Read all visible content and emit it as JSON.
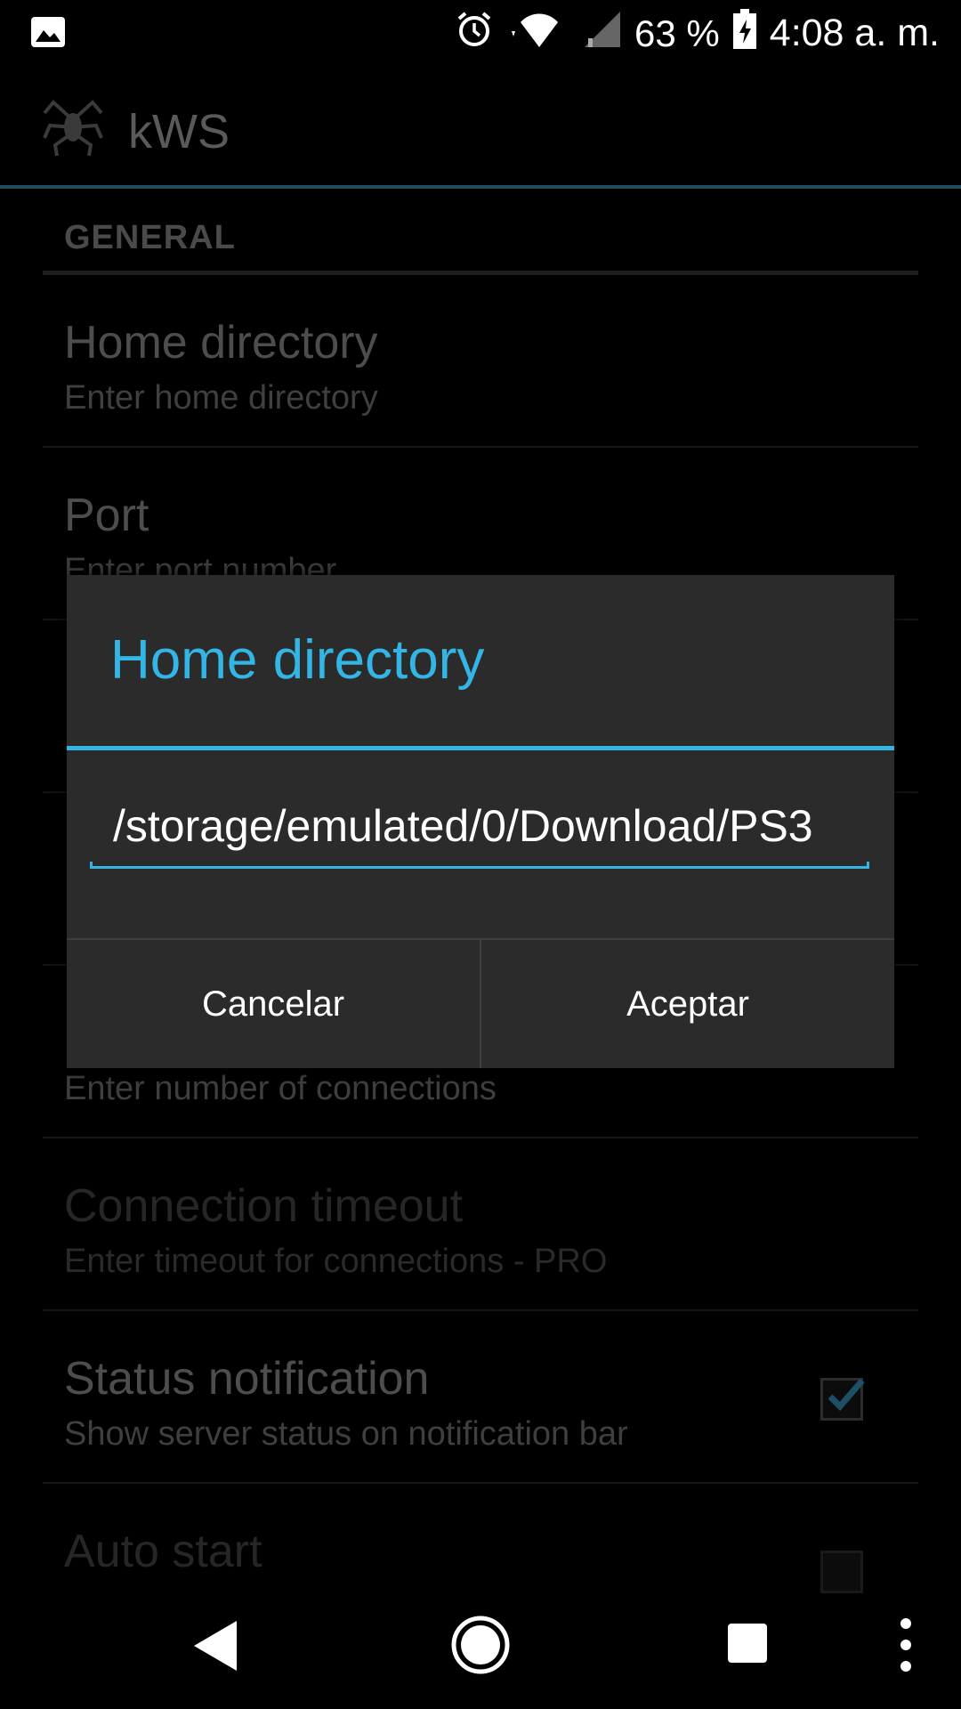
{
  "status_bar": {
    "battery_percent": "63 %",
    "time": "4:08 a. m.",
    "icons": [
      "image-icon",
      "alarm-icon",
      "wifi-icon",
      "signal-icon",
      "battery-charging-icon"
    ]
  },
  "app_bar": {
    "title": "kWS",
    "logo_icon": "spider-logo-icon"
  },
  "preferences": {
    "category": "GENERAL",
    "items": [
      {
        "title": "Home directory",
        "summary": "Enter home directory"
      },
      {
        "title": "Port",
        "summary": "Enter port number"
      },
      {
        "title": "",
        "summary": "Enter number of connections"
      },
      {
        "title": "Connection timeout",
        "summary": "Enter timeout for connections - PRO"
      },
      {
        "title": "Status notification",
        "summary": "Show server status on notification bar",
        "checked": true
      },
      {
        "title": "Auto start",
        "summary": ""
      }
    ]
  },
  "dialog": {
    "title": "Home directory",
    "input_value": "/storage/emulated/0/Download/PS3",
    "cancel_label": "Cancelar",
    "ok_label": "Aceptar"
  },
  "nav_bar": {
    "icons": [
      "back-icon",
      "home-icon",
      "recents-icon",
      "more-icon"
    ]
  },
  "colors": {
    "accent": "#33b5e5",
    "dialog_bg": "#2b2b2b"
  }
}
